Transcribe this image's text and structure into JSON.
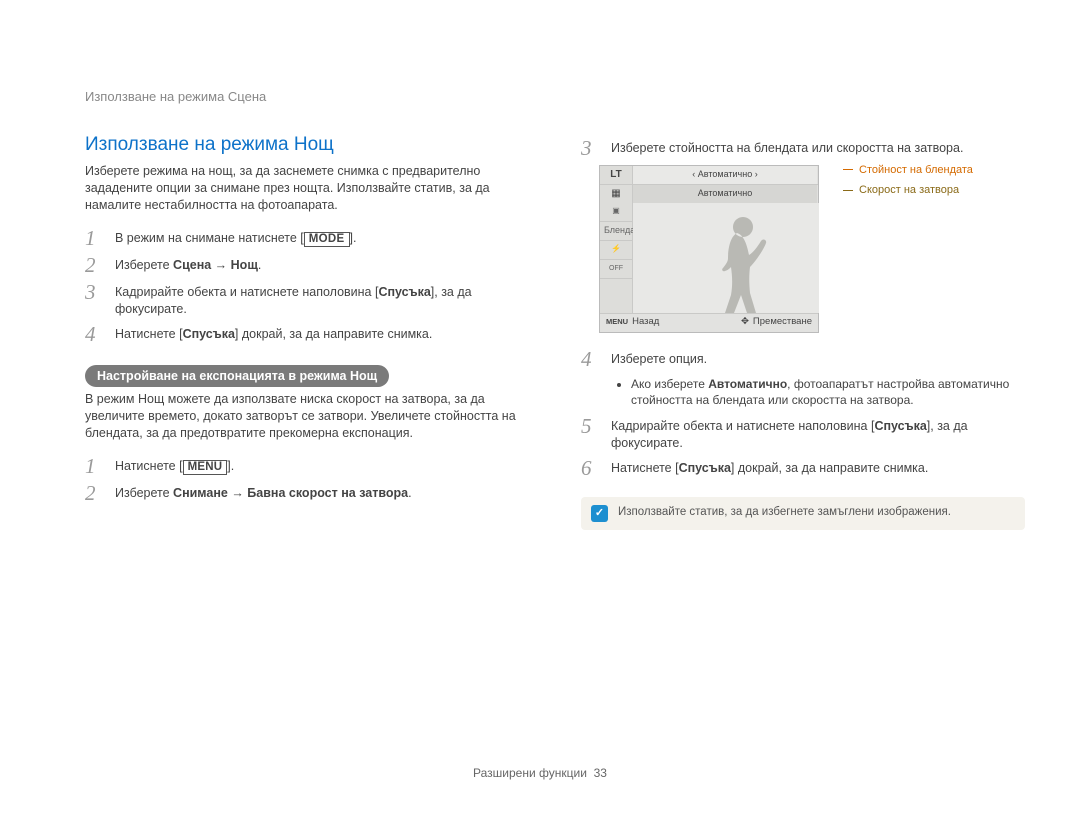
{
  "breadcrumb": "Използване на режима Сцена",
  "section_title": "Използване на режима Нощ",
  "intro": "Изберете режима на нощ, за да заснемете снимка с предварително зададените опции за снимане през нощта. Използвайте статив, за да намалите нестабилността на фотоапарата.",
  "left_steps": {
    "1": {
      "pre": "В режим на снимане натиснете [",
      "btn": "MODE",
      "post": "]."
    },
    "2": {
      "pre": "Изберете ",
      "bold": "Сцена → Нощ",
      "post": "."
    },
    "3": {
      "pre": "Кадрирайте обекта и натиснете наполовина [",
      "bold": "Спусъка",
      "post": "], за да фокусирате."
    },
    "4": {
      "pre": "Натиснете [",
      "bold": "Спусъка",
      "post": "] докрай, за да направите снимка."
    }
  },
  "subhead": "Настройване на експонацията в режима Нощ",
  "sub_intro": "В режим Нощ можете да използвате ниска скорост на затвора, за да увеличите времето, докато затворът се затвори. Увеличете стойността на блендата, за да предотвратите прекомерна експонация.",
  "left_steps_b": {
    "1": {
      "pre": "Натиснете [",
      "btn": "MENU",
      "post": "]."
    },
    "2": {
      "pre": "Изберете ",
      "bold": "Снимане → Бавна скорост на затвора",
      "post": "."
    }
  },
  "right_steps": {
    "3": "Изберете стойността на блендата или скоростта на затвора.",
    "4": "Изберете опция.",
    "4_sub": "Ако изберете Автоматично, фотоапаратът настройва автоматично стойността на блендата или скоростта на затвора.",
    "4_sub_bold": "Автоматично",
    "5": {
      "pre": "Кадрирайте обекта и натиснете наполовина [",
      "bold": "Спусъка",
      "post": "], за да фокусирате."
    },
    "6": {
      "pre": "Натиснете [",
      "bold": "Спусъка",
      "post": "] докрай, за да направите снимка."
    }
  },
  "lcd": {
    "lt": "LT",
    "auto_top": "‹ Автоматично ›",
    "auto_sel": "Автоматично",
    "label": "Бленда",
    "off": "OFF",
    "menu_small": "MENU",
    "back": "Назад",
    "move": "Преместване"
  },
  "callouts": {
    "c1": "Стойност на блендата",
    "c2": "Скорост на затвора"
  },
  "tip": "Използвайте статив, за да избегнете замъглени изображения.",
  "footer_label": "Разширени функции",
  "footer_page": "33"
}
